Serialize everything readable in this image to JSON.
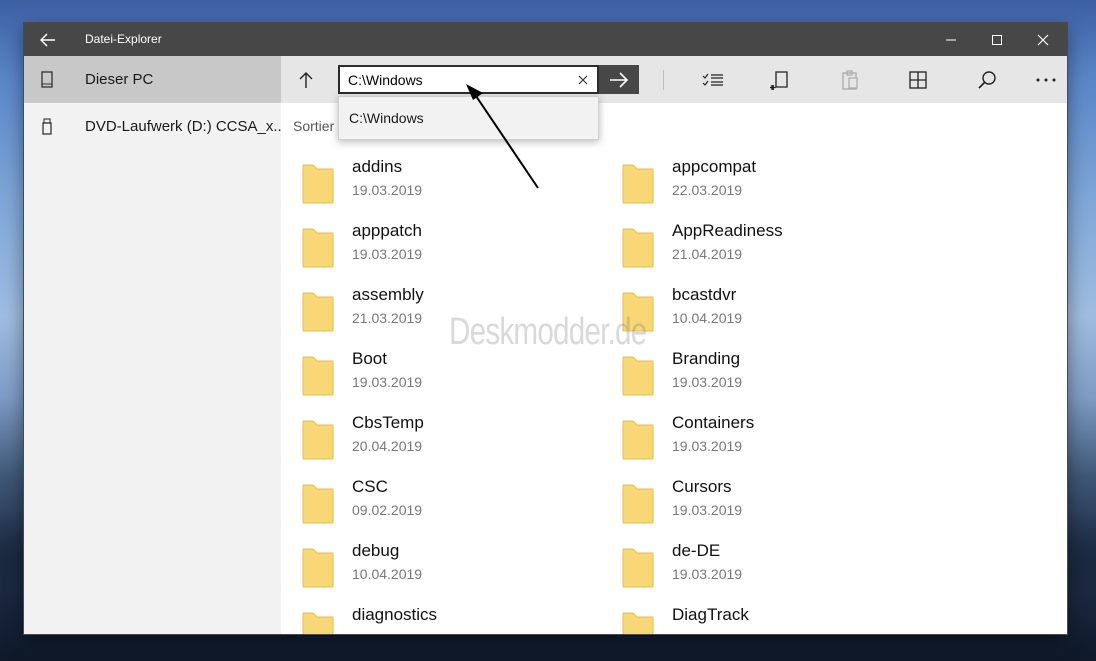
{
  "window": {
    "title": "Datei-Explorer"
  },
  "sidebar": {
    "items": [
      {
        "label": "Dieser PC",
        "icon": "drive-icon"
      },
      {
        "label": "DVD-Laufwerk (D:) CCSA_x...",
        "icon": "usb-drive-icon"
      }
    ]
  },
  "address": {
    "value": "C:\\Windows",
    "suggestion": "C:\\Windows"
  },
  "content": {
    "sort_label": "Sortier",
    "folders": [
      {
        "name": "addins",
        "date": "19.03.2019"
      },
      {
        "name": "appcompat",
        "date": "22.03.2019"
      },
      {
        "name": "apppatch",
        "date": "19.03.2019"
      },
      {
        "name": "AppReadiness",
        "date": "21.04.2019"
      },
      {
        "name": "assembly",
        "date": "21.03.2019"
      },
      {
        "name": "bcastdvr",
        "date": "10.04.2019"
      },
      {
        "name": "Boot",
        "date": "19.03.2019"
      },
      {
        "name": "Branding",
        "date": "19.03.2019"
      },
      {
        "name": "CbsTemp",
        "date": "20.04.2019"
      },
      {
        "name": "Containers",
        "date": "19.03.2019"
      },
      {
        "name": "CSC",
        "date": "09.02.2019"
      },
      {
        "name": "Cursors",
        "date": "19.03.2019"
      },
      {
        "name": "debug",
        "date": "10.04.2019"
      },
      {
        "name": "de-DE",
        "date": "19.03.2019"
      },
      {
        "name": "diagnostics",
        "date": ""
      },
      {
        "name": "DiagTrack",
        "date": ""
      }
    ]
  },
  "watermark": "Deskmodder.de",
  "colors": {
    "titlebar": "#474747",
    "sidebar_selected": "#c8c8c8",
    "folder": "#f8d776"
  }
}
